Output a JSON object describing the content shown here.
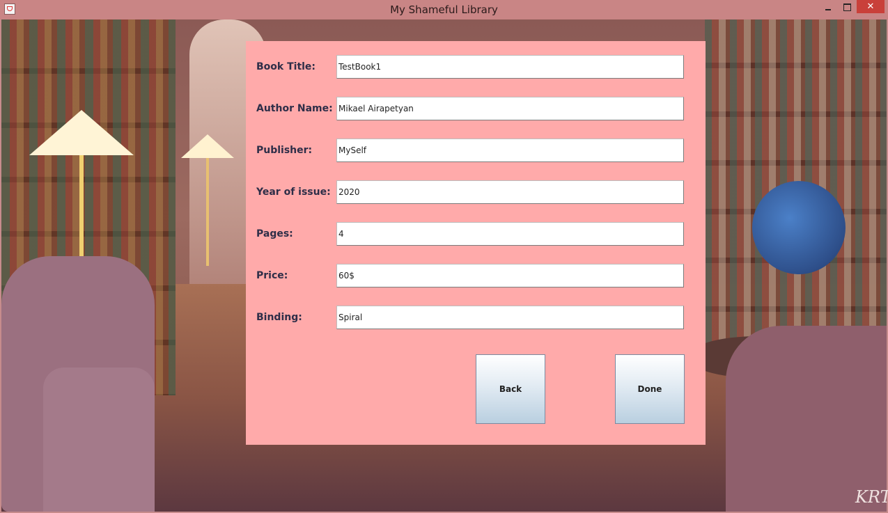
{
  "window": {
    "title": "My Shameful Library",
    "close_glyph": "✕",
    "icons": [
      "java-cup-icon",
      "minimize-icon",
      "maximize-icon",
      "close-icon"
    ]
  },
  "form": {
    "fields": [
      {
        "label": "Book Title:",
        "value": "TestBook1"
      },
      {
        "label": "Author Name:",
        "value": "Mikael Airapetyan"
      },
      {
        "label": "Publisher:",
        "value": "MySelf"
      },
      {
        "label": "Year of issue:",
        "value": "2020"
      },
      {
        "label": "Pages:",
        "value": "4"
      },
      {
        "label": "Price:",
        "value": "60$"
      },
      {
        "label": "Binding:",
        "value": "Spiral"
      }
    ],
    "back_label": "Back",
    "done_label": "Done"
  },
  "background": {
    "signature": "KRT"
  },
  "colors": {
    "title_bar": "#c98585",
    "panel": "#ffaaaa",
    "close_button": "#c9403a"
  }
}
